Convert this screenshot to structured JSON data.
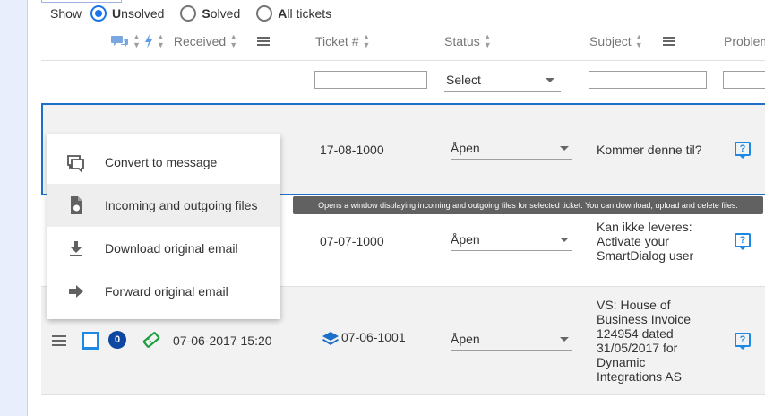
{
  "show_filter": {
    "label": "Show",
    "options": [
      {
        "first": "U",
        "rest": "nsolved",
        "checked": true
      },
      {
        "first": "S",
        "rest": "olved",
        "checked": false
      },
      {
        "first": "A",
        "rest": "ll tickets",
        "checked": false
      }
    ]
  },
  "columns": {
    "received": "Received",
    "ticket": "Ticket #",
    "status": "Status",
    "subject": "Subject",
    "problem": "Problem"
  },
  "filters": {
    "status_placeholder": "Select"
  },
  "rows": [
    {
      "ticket": "17-08-1000",
      "status": "Åpen",
      "subject": "Kommer denne til?"
    },
    {
      "ticket": "07-07-1000",
      "status": "Åpen",
      "subject_lines": [
        "Kan ikke leveres:",
        "Activate your",
        "SmartDialog user"
      ]
    },
    {
      "received": "07-06-2017 15:20",
      "badge": "0",
      "ticket": "07-06-1001",
      "status": "Åpen",
      "subject_lines": [
        "VS: House of",
        "Business Invoice",
        "124954 dated",
        "31/05/2017 for",
        "Dynamic",
        "Integrations AS"
      ]
    }
  ],
  "context_menu": {
    "items": [
      {
        "label": "Convert to message",
        "icon": "convert-message-icon"
      },
      {
        "label": "Incoming and outgoing files",
        "icon": "files-icon"
      },
      {
        "label": "Download original email",
        "icon": "download-icon"
      },
      {
        "label": "Forward original email",
        "icon": "forward-icon"
      }
    ]
  },
  "tooltip": "Opens a window displaying incoming and outgoing files for selected ticket. You can download, upload and delete files.",
  "colors": {
    "accent": "#1e88e5",
    "selected_border": "#1e6fc8",
    "badge": "#0d47a1",
    "tooltip_bg": "#616161"
  }
}
